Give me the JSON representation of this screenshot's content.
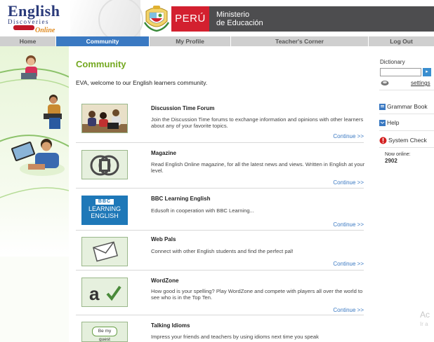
{
  "header": {
    "logo_word": "English",
    "logo_sub": "Discoveries",
    "logo_online": "Online",
    "country_label": "PERÚ",
    "ministry_line1": "Ministerio",
    "ministry_line2": "de Educación"
  },
  "nav": [
    {
      "label": "Home",
      "active": false
    },
    {
      "label": "Community",
      "active": true
    },
    {
      "label": "My Profile",
      "active": false
    },
    {
      "label": "Teacher's Corner",
      "active": false
    },
    {
      "label": "Log Out",
      "active": false
    }
  ],
  "main": {
    "title": "Community",
    "welcome": "EVA, welcome to our English learners community.",
    "items": [
      {
        "title": "Discussion Time Forum",
        "desc": "Join the Discussion Time forums to exchange information and opinions with other learners about any of your favorite topics.",
        "link": "Continue >>"
      },
      {
        "title": "Magazine",
        "desc": "Read English Online magazine, for all the latest news and views. Written in English at your level.",
        "link": "Continue >>"
      },
      {
        "title": "BBC Learning English",
        "desc": "Edusoft in cooperation with BBC Learning...",
        "link": "Continue >>",
        "thumb_lines": [
          "BBC",
          "LEARNING",
          "ENGLISH"
        ]
      },
      {
        "title": "Web Pals",
        "desc": "Connect with other English students and find the perfect pal!",
        "link": "Continue >>"
      },
      {
        "title": "WordZone",
        "desc": "How good is your spelling? Play WordZone and compete with players all over the world to see who is in the Top Ten.",
        "link": "Continue >>"
      },
      {
        "title": "Talking Idioms",
        "desc": "Impress your friends and teachers by using idioms next time you speak",
        "link": "",
        "thumb_text": "Be my guest"
      }
    ]
  },
  "sidebar": {
    "dictionary_label": "Dictionary",
    "dictionary_value": "",
    "go_label": "▸",
    "settings_label": "settings",
    "grammar_book": "Grammar Book",
    "help": "Help",
    "system_check": "System Check",
    "now_online_label": "Now online:",
    "now_online_count": "2902"
  },
  "watermark": {
    "line1": "Ac",
    "line2": "Ir a"
  },
  "colors": {
    "accent_blue": "#3a79c2",
    "title_green": "#74a820",
    "peru_red": "#d3202f",
    "ministry_gray": "#4d4d4f"
  }
}
